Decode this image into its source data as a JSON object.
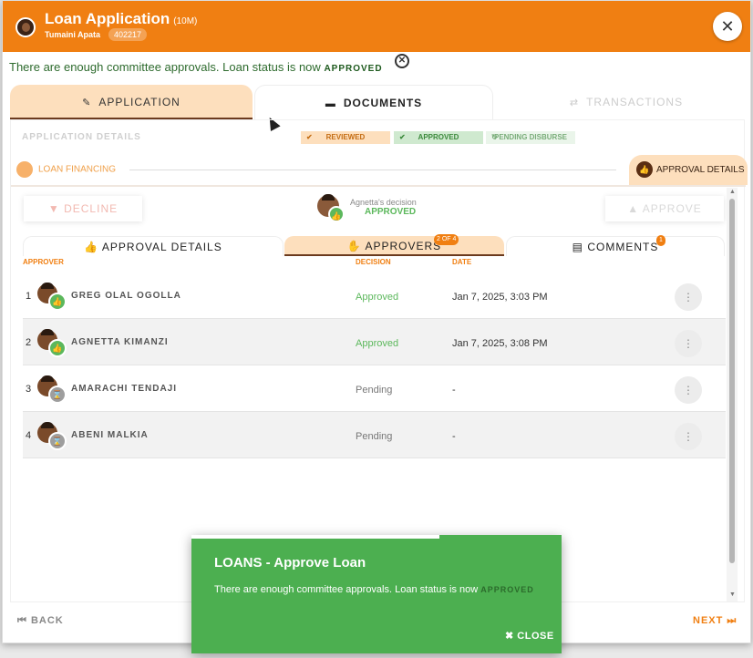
{
  "header": {
    "title": "Loan Application",
    "title_suffix": "(10M)",
    "subtitle": "Tumaini Apata",
    "badge": "402217",
    "close_icon": "close-icon"
  },
  "status_message": {
    "text": "There are enough committee approvals. Loan status is now",
    "status": "APPROVED"
  },
  "tabs": [
    {
      "label": "APPLICATION",
      "icon": "user-edit-icon"
    },
    {
      "label": "DOCUMENTS",
      "icon": "folder-icon"
    },
    {
      "label": "TRANSACTIONS",
      "icon": "transactions-icon"
    }
  ],
  "section_label": "APPLICATION DETAILS",
  "steps": [
    "REVIEWED",
    "APPROVED",
    "PENDING DISBURSE"
  ],
  "loan_financing": "LOAN FINANCING",
  "approval_details_pill": "APPROVAL DETAILS",
  "actions": {
    "decline": "DECLINE",
    "approve": "APPROVE"
  },
  "decision": {
    "name": "Agnetta's decision",
    "value": "APPROVED"
  },
  "subtabs": [
    {
      "label": "APPROVAL DETAILS"
    },
    {
      "label": "APPROVERS",
      "badge": "2 OF 4"
    },
    {
      "label": "COMMENTS",
      "badge": "1"
    }
  ],
  "table": {
    "headers": [
      "APPROVER",
      "DECISION",
      "DATE"
    ],
    "rows": [
      {
        "num": "1",
        "name": "GREG OLAL OGOLLA",
        "decision": "Approved",
        "date": "Jan 7, 2025, 3:03 PM"
      },
      {
        "num": "2",
        "name": "AGNETTA KIMANZI",
        "decision": "Approved",
        "date": "Jan 7, 2025, 3:08 PM"
      },
      {
        "num": "3",
        "name": "AMARACHI TENDAJI",
        "decision": "Pending",
        "date": "-"
      },
      {
        "num": "4",
        "name": "ABENI MALKIA",
        "decision": "Pending",
        "date": "-"
      }
    ]
  },
  "footer": {
    "back": "BACK",
    "next": "NEXT"
  },
  "toast": {
    "title": "LOANS - Approve Loan",
    "message": "There are enough committee approvals. Loan status is now",
    "status": "APPROVED",
    "close": "CLOSE"
  },
  "colors": {
    "brand": "#f07f12",
    "success": "#4caf50",
    "tab_active": "#fddfbd"
  }
}
